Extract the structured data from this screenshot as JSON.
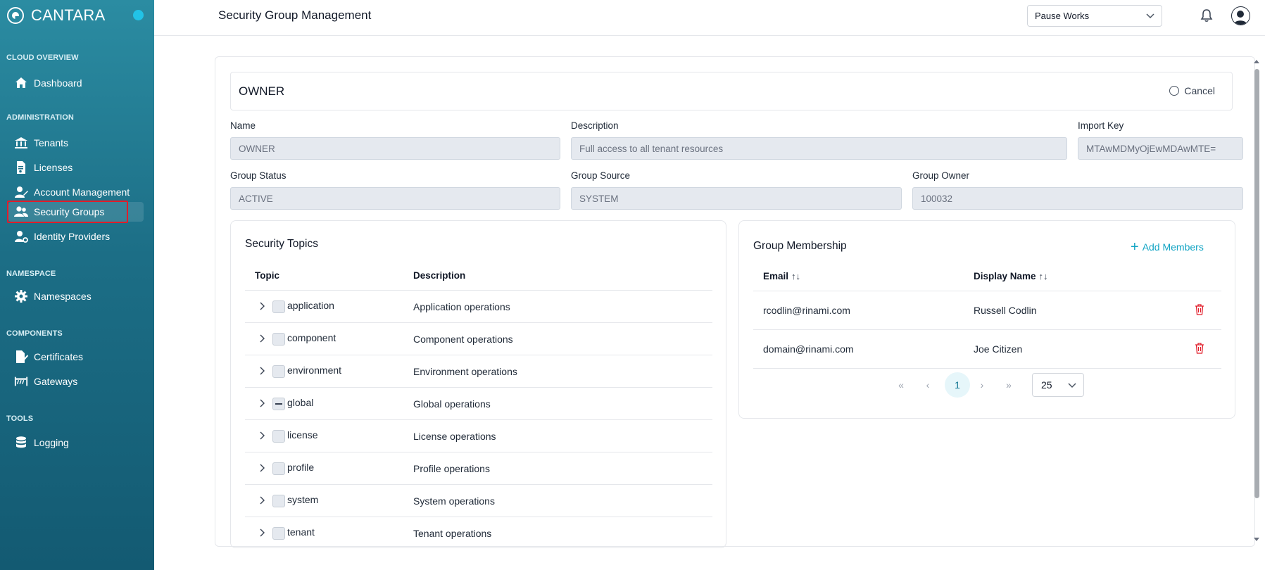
{
  "brand": {
    "name": "CANTARA"
  },
  "sidebar": {
    "sections": [
      {
        "label": "CLOUD OVERVIEW",
        "items": [
          {
            "label": "Dashboard",
            "icon": "home-icon"
          }
        ]
      },
      {
        "label": "ADMINISTRATION",
        "items": [
          {
            "label": "Tenants",
            "icon": "tenants-icon"
          },
          {
            "label": "Licenses",
            "icon": "license-icon"
          },
          {
            "label": "Account Management",
            "icon": "account-icon"
          },
          {
            "label": "Security Groups",
            "icon": "users-icon",
            "active": true
          },
          {
            "label": "Identity Providers",
            "icon": "identity-icon"
          }
        ]
      },
      {
        "label": "NAMESPACE",
        "items": [
          {
            "label": "Namespaces",
            "icon": "gear-icon"
          }
        ]
      },
      {
        "label": "COMPONENTS",
        "items": [
          {
            "label": "Certificates",
            "icon": "certificate-icon"
          },
          {
            "label": "Gateways",
            "icon": "gateway-icon"
          }
        ]
      },
      {
        "label": "TOOLS",
        "items": [
          {
            "label": "Logging",
            "icon": "database-icon"
          }
        ]
      }
    ]
  },
  "header": {
    "title": "Security Group Management",
    "workspace": "Pause Works"
  },
  "group": {
    "title": "OWNER",
    "cancel_label": "Cancel",
    "fields": {
      "name": {
        "label": "Name",
        "value": "OWNER"
      },
      "description": {
        "label": "Description",
        "value": "Full access to all tenant resources"
      },
      "import_key": {
        "label": "Import Key",
        "value": "MTAwMDMyOjEwMDAwMTE="
      },
      "status": {
        "label": "Group Status",
        "value": "ACTIVE"
      },
      "source": {
        "label": "Group Source",
        "value": "SYSTEM"
      },
      "owner": {
        "label": "Group Owner",
        "value": "100032"
      }
    }
  },
  "topics": {
    "heading": "Security Topics",
    "columns": [
      "Topic",
      "Description"
    ],
    "rows": [
      {
        "topic": "application",
        "description": "Application operations",
        "state": "unchecked"
      },
      {
        "topic": "component",
        "description": "Component operations",
        "state": "unchecked"
      },
      {
        "topic": "environment",
        "description": "Environment operations",
        "state": "unchecked"
      },
      {
        "topic": "global",
        "description": "Global operations",
        "state": "partial"
      },
      {
        "topic": "license",
        "description": "License operations",
        "state": "unchecked"
      },
      {
        "topic": "profile",
        "description": "Profile operations",
        "state": "unchecked"
      },
      {
        "topic": "system",
        "description": "System operations",
        "state": "unchecked"
      },
      {
        "topic": "tenant",
        "description": "Tenant operations",
        "state": "unchecked"
      }
    ]
  },
  "membership": {
    "heading": "Group Membership",
    "add_label": "Add Members",
    "columns": [
      "Email",
      "Display Name"
    ],
    "rows": [
      {
        "email": "rcodlin@rinami.com",
        "display_name": "Russell Codlin"
      },
      {
        "email": "domain@rinami.com",
        "display_name": "Joe Citizen"
      }
    ],
    "pagination": {
      "first": "«",
      "prev": "‹",
      "current": "1",
      "next": "›",
      "last": "»",
      "page_size": "25"
    }
  },
  "colors": {
    "accent": "#12a4c4",
    "danger": "#e11d2a",
    "sidebar_top": "#2b8ca2",
    "sidebar_bottom": "#135a72"
  }
}
